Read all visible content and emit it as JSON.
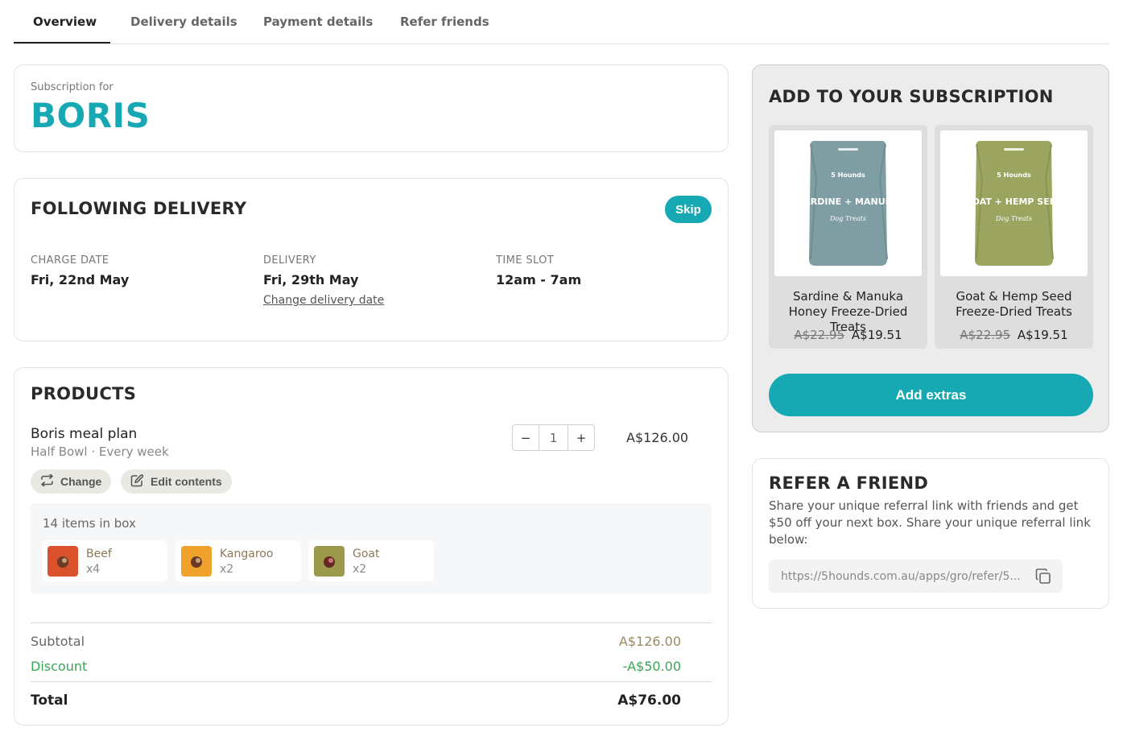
{
  "tabs": [
    "Overview",
    "Delivery details",
    "Payment details",
    "Refer friends"
  ],
  "subscription": {
    "label": "Subscription for",
    "name": "BORIS"
  },
  "following_delivery": {
    "title": "FOLLOWING DELIVERY",
    "skip_label": "Skip",
    "charge_date_label": "CHARGE DATE",
    "charge_date": "Fri, 22nd May",
    "delivery_label": "DELIVERY",
    "delivery_date": "Fri, 29th May",
    "change_delivery_link": "Change delivery date",
    "time_slot_label": "TIME SLOT",
    "time_slot": "12am - 7am"
  },
  "products": {
    "title": "PRODUCTS",
    "plan_name": "Boris meal plan",
    "plan_details": "Half Bowl · Every week",
    "quantity": "1",
    "minus": "−",
    "plus": "+",
    "price": "A$126.00",
    "change_label": "Change",
    "edit_label": "Edit contents",
    "box_count": "14 items in box",
    "items": [
      {
        "name": "Beef",
        "qty": "x4",
        "color": "#d9522b"
      },
      {
        "name": "Kangaroo",
        "qty": "x2",
        "color": "#f0a22c"
      },
      {
        "name": "Goat",
        "qty": "x2",
        "color": "#9a9a4a"
      }
    ],
    "subtotal_label": "Subtotal",
    "subtotal": "A$126.00",
    "discount_label": "Discount",
    "discount": "-A$50.00",
    "total_label": "Total",
    "total": "A$76.00"
  },
  "add_to_subscription": {
    "title": "ADD TO YOUR SUBSCRIPTION",
    "extras": [
      {
        "name": "Sardine & Manuka Honey Freeze-Dried Treats",
        "old_price": "A$22.95",
        "price": "A$19.51",
        "pack_color": "#7f9ea3",
        "pack_title": "SARDINE + MANUKA",
        "brand": "5 Hounds",
        "script": "Dog Treats"
      },
      {
        "name": "Goat & Hemp Seed Freeze-Dried Treats",
        "old_price": "A$22.95",
        "price": "A$19.51",
        "pack_color": "#9ba55f",
        "pack_title": "GOAT + HEMP SEED",
        "brand": "5 Hounds",
        "script": "Dog Treats"
      }
    ],
    "button_label": "Add extras"
  },
  "refer": {
    "title": "REFER A FRIEND",
    "description": "Share your unique referral link with friends and get $50 off your next box. Share your unique referral link below:",
    "link": "https://5hounds.com.au/apps/gro/refer/5..."
  },
  "colors": {
    "accent": "#16a9b3",
    "discount": "#3aa555"
  }
}
